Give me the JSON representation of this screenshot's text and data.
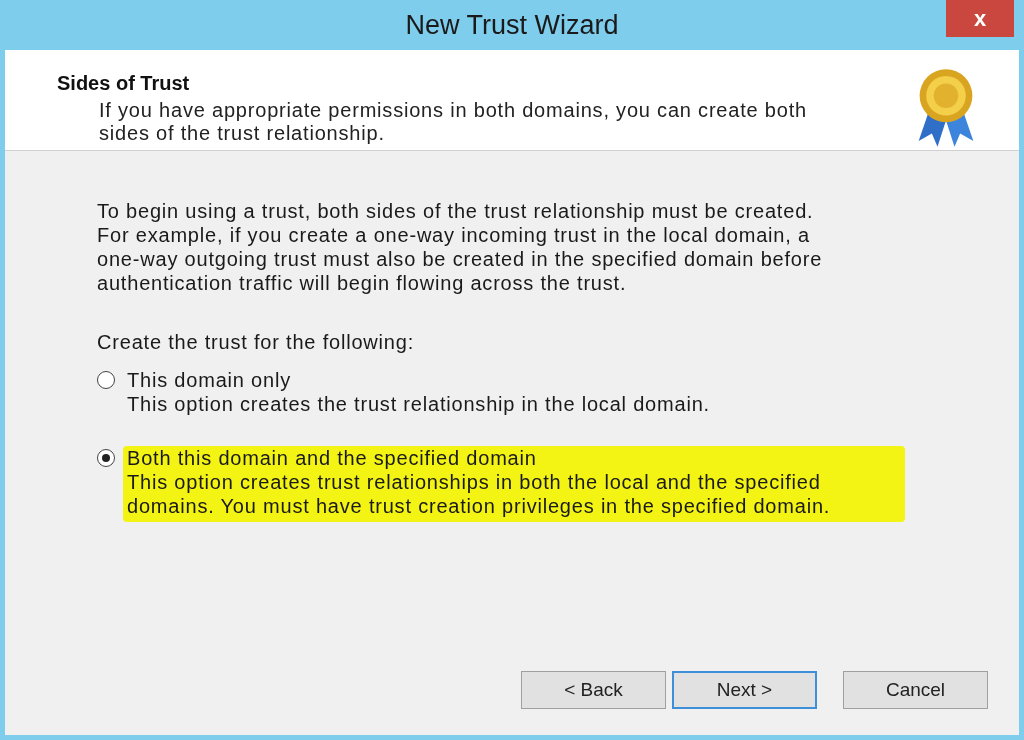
{
  "window": {
    "title": "New Trust Wizard",
    "close": "x"
  },
  "header": {
    "title": "Sides of Trust",
    "description": "If you have appropriate permissions in both domains, you can create both sides of the trust relationship."
  },
  "intro": "To begin using a trust, both sides of the trust relationship must be created. For example, if you create a one-way incoming trust in the local domain, a one-way outgoing trust must also be created in the specified domain before authentication traffic will begin flowing across the trust.",
  "prompt": "Create the trust for the following:",
  "options": [
    {
      "label": "This domain only",
      "description": "This option creates the trust relationship in the local domain.",
      "selected": false,
      "highlighted": false
    },
    {
      "label": "Both this domain and the specified domain",
      "description": "This option creates trust relationships in both the local and the specified domains. You must have trust creation privileges in the specified domain.",
      "selected": true,
      "highlighted": true
    }
  ],
  "buttons": [
    {
      "label": "< Back",
      "selected": false
    },
    {
      "label": "Next >",
      "selected": true
    },
    {
      "label": "Cancel",
      "selected": false
    }
  ]
}
